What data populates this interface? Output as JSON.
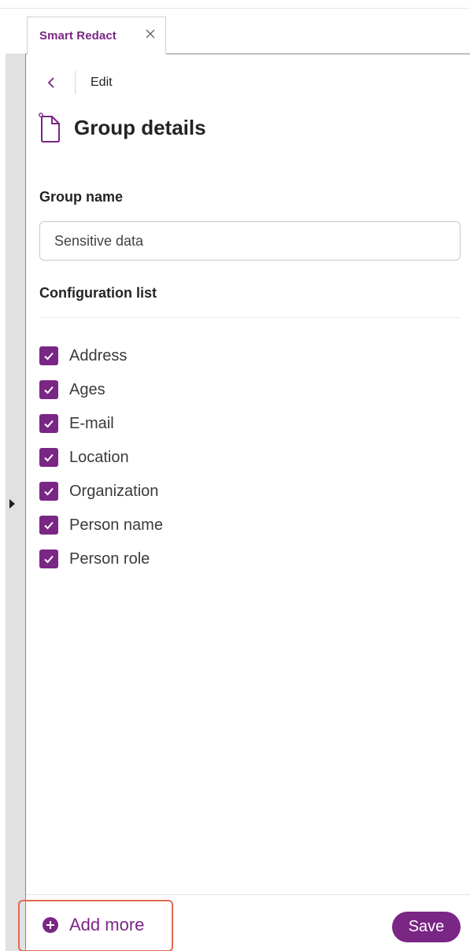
{
  "tab": {
    "title": "Smart Redact",
    "close_icon": "close-icon"
  },
  "header": {
    "back_icon": "chevron-left-icon",
    "edit_label": "Edit"
  },
  "page": {
    "title": "Group details",
    "title_icon": "document-icon"
  },
  "group_name": {
    "label": "Group name",
    "value": "Sensitive data"
  },
  "configuration": {
    "label": "Configuration list",
    "items": [
      {
        "label": "Address",
        "checked": true
      },
      {
        "label": "Ages",
        "checked": true
      },
      {
        "label": "E-mail",
        "checked": true
      },
      {
        "label": "Location",
        "checked": true
      },
      {
        "label": "Organization",
        "checked": true
      },
      {
        "label": "Person name",
        "checked": true
      },
      {
        "label": "Person role",
        "checked": true
      }
    ]
  },
  "footer": {
    "add_more_label": "Add more",
    "add_more_icon": "plus-circle-icon",
    "save_label": "Save"
  },
  "colors": {
    "accent": "#7a2685",
    "highlight": "#e2684f"
  }
}
